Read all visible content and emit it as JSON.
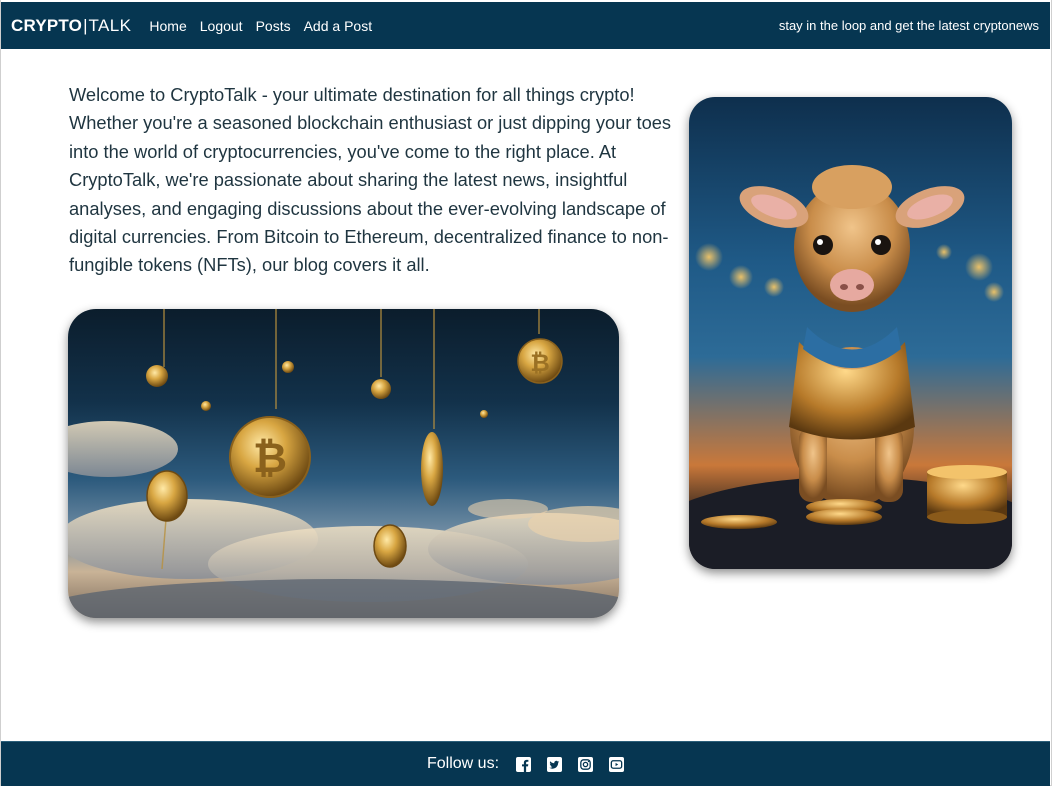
{
  "brand": {
    "bold": "CRYPTO",
    "separator": "|",
    "light": "TALK"
  },
  "nav": {
    "links": [
      {
        "label": "Home"
      },
      {
        "label": "Logout"
      },
      {
        "label": "Posts"
      },
      {
        "label": "Add a Post"
      }
    ],
    "tagline": "stay in the loop and get the latest cryptonews"
  },
  "intro": {
    "text": "Welcome to CryptoTalk - your ultimate destination for all things crypto! Whether you're a seasoned blockchain enthusiast or just dipping your toes into the world of cryptocurrencies, you've come to the right place. At CryptoTalk, we're passionate about sharing the latest news, insightful analyses, and engaging discussions about the ever-evolving landscape of digital currencies. From Bitcoin to Ethereum, decentralized finance to non-fungible tokens (NFTs), our blog covers it all."
  },
  "footer": {
    "follow_label": "Follow us:",
    "social": [
      "facebook-icon",
      "twitter-icon",
      "instagram-icon",
      "youtube-icon"
    ]
  },
  "colors": {
    "navbar": "#063651",
    "text": "#1f3540",
    "white": "#ffffff"
  }
}
